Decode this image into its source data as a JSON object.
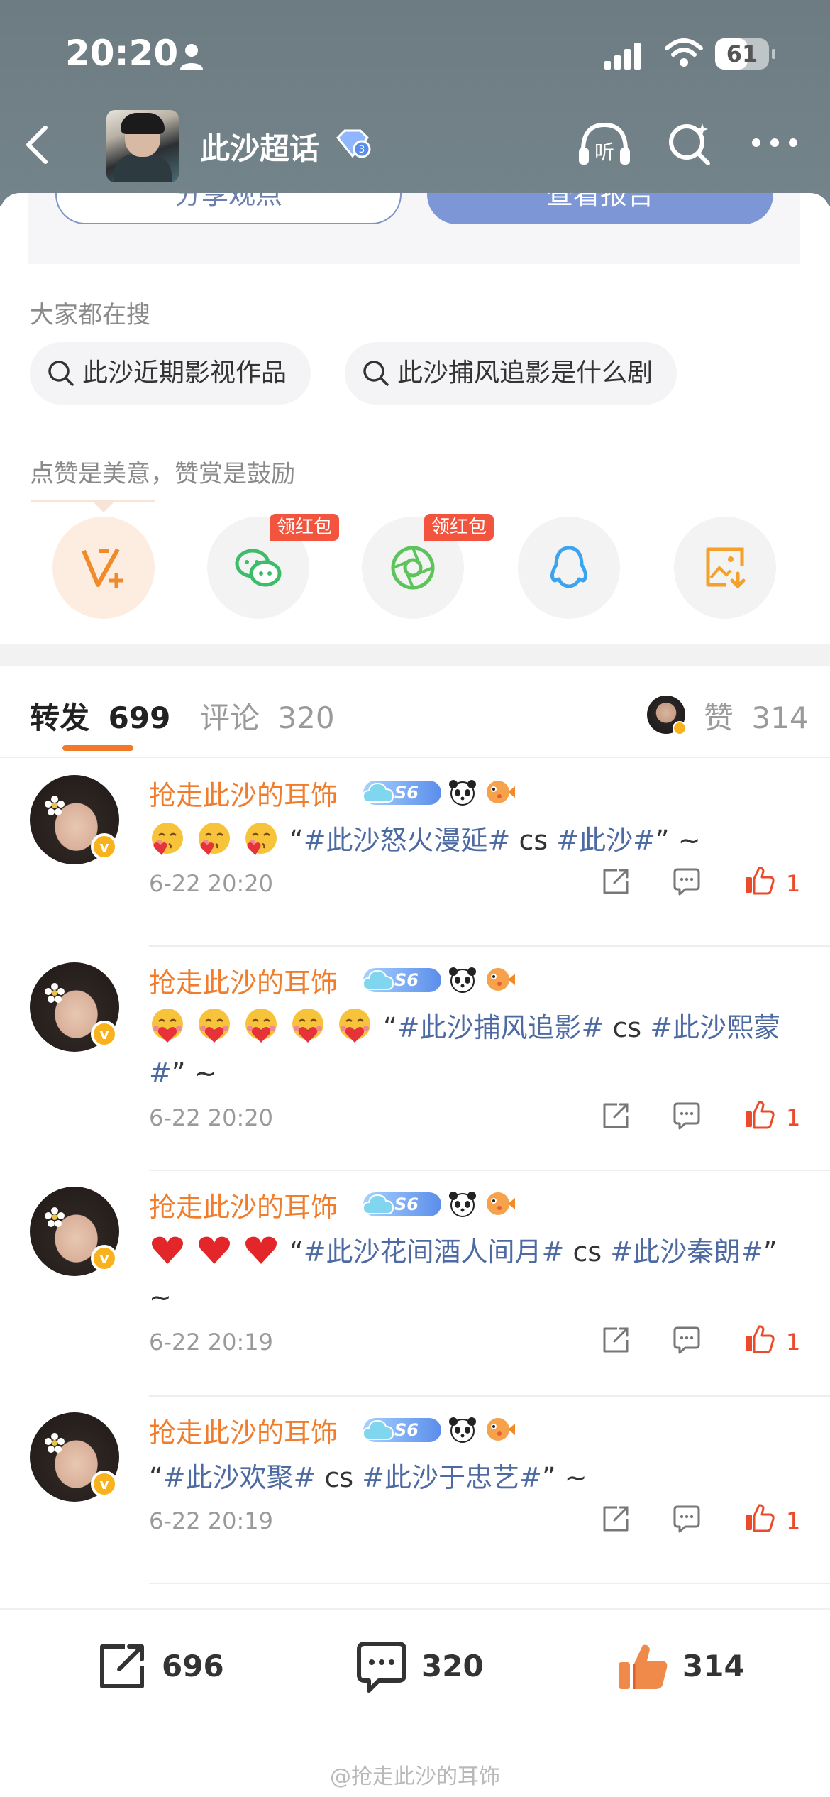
{
  "status_bar": {
    "time": "20:20",
    "battery": "61",
    "battery_level": 0.61
  },
  "nav": {
    "title": "此沙超话"
  },
  "actions": {
    "share_label": "分享观点",
    "report_label": "查看报告"
  },
  "search": {
    "label": "大家都在搜",
    "chips": [
      "此沙近期影视作品",
      "此沙捕风追影是什么剧"
    ]
  },
  "share": {
    "label": "点赞是美意，赞赏是鼓励",
    "badge": "领红包",
    "targets": [
      "vplus-icon",
      "wechat-icon",
      "moments-icon",
      "qq-icon",
      "save-image-icon"
    ]
  },
  "tabs": {
    "repost_label": "转发",
    "repost_count": "699",
    "comment_label": "评论",
    "comment_count": "320",
    "like_label": "赞",
    "like_count": "314"
  },
  "items": [
    {
      "username": "抢走此沙的耳饰",
      "vip": "S6",
      "content_prefix": "“",
      "tag1": "#此沙怒火漫延#",
      "middle": " cs ",
      "tag2": "#此沙#",
      "suffix": "” ~",
      "emojis": [
        "kiss-heart-emoji",
        "kiss-heart-emoji",
        "kiss-heart-emoji"
      ],
      "time": "6-22 20:20",
      "likes": "1"
    },
    {
      "username": "抢走此沙的耳饰",
      "vip": "S6",
      "content_prefix": "“",
      "tag1": "#此沙捕风追影#",
      "middle": " cs ",
      "tag2": "#此沙熙蒙#",
      "suffix": "” ~",
      "emojis": [
        "heart-hug-emoji",
        "heart-hug-emoji",
        "heart-hug-emoji",
        "heart-hug-emoji",
        "heart-hug-emoji"
      ],
      "time": "6-22 20:20",
      "likes": "1"
    },
    {
      "username": "抢走此沙的耳饰",
      "vip": "S6",
      "content_prefix": "“",
      "tag1": "#此沙花间酒人间月#",
      "middle": " cs ",
      "tag2": "#此沙秦朗#",
      "suffix": "” ~",
      "emojis": [
        "red-heart-emoji",
        "red-heart-emoji",
        "red-heart-emoji"
      ],
      "time": "6-22 20:19",
      "likes": "1"
    },
    {
      "username": "抢走此沙的耳饰",
      "vip": "S6",
      "content_prefix": "“",
      "tag1": "#此沙欢聚#",
      "middle": " cs ",
      "tag2": "#此沙于忠艺#",
      "suffix": "” ~",
      "emojis": [],
      "time": "6-22 20:19",
      "likes": "1"
    }
  ],
  "bottom_bar": {
    "repost": "696",
    "comment": "320",
    "like": "314"
  },
  "watermark": "@抢走此沙的耳饰",
  "colors": {
    "accent": "#ef7d2c",
    "link": "#4d6aa3",
    "report_button": "#7d97d6",
    "like": "#e94b2b"
  }
}
